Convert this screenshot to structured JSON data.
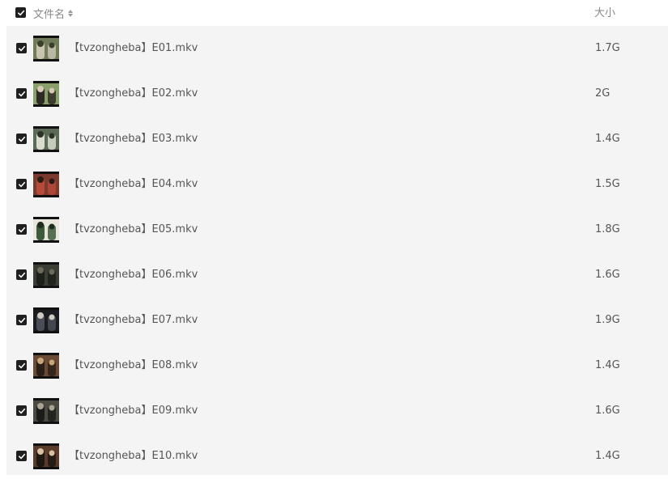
{
  "header": {
    "name_label": "文件名",
    "size_label": "大小",
    "select_all_checked": true
  },
  "files": [
    {
      "name": "【tvzongheba】E01.mkv",
      "size": "1.7G",
      "checked": true,
      "thumb_palette": [
        "#6f7b59",
        "#c8c4b0",
        "#3a3f2c"
      ]
    },
    {
      "name": "【tvzongheba】E02.mkv",
      "size": "2G",
      "checked": true,
      "thumb_palette": [
        "#8aa06a",
        "#2e2a25",
        "#d7c9b4"
      ]
    },
    {
      "name": "【tvzongheba】E03.mkv",
      "size": "1.4G",
      "checked": true,
      "thumb_palette": [
        "#5b6b55",
        "#d9dccf",
        "#2b3126"
      ]
    },
    {
      "name": "【tvzongheba】E04.mkv",
      "size": "1.5G",
      "checked": true,
      "thumb_palette": [
        "#7a3b2e",
        "#b84a3a",
        "#2a1a14"
      ]
    },
    {
      "name": "【tvzongheba】E05.mkv",
      "size": "1.8G",
      "checked": true,
      "thumb_palette": [
        "#e8e6dc",
        "#3d5a3b",
        "#1f2a20"
      ]
    },
    {
      "name": "【tvzongheba】E06.mkv",
      "size": "1.6G",
      "checked": true,
      "thumb_palette": [
        "#3b3e34",
        "#1d1f1a",
        "#6c6a5a"
      ]
    },
    {
      "name": "【tvzongheba】E07.mkv",
      "size": "1.9G",
      "checked": true,
      "thumb_palette": [
        "#1b1c1f",
        "#4a4d55",
        "#d0ccc4"
      ]
    },
    {
      "name": "【tvzongheba】E08.mkv",
      "size": "1.4G",
      "checked": true,
      "thumb_palette": [
        "#6a4a33",
        "#2a2018",
        "#c8a478"
      ]
    },
    {
      "name": "【tvzongheba】E09.mkv",
      "size": "1.6G",
      "checked": true,
      "thumb_palette": [
        "#4b4a42",
        "#1c1c1a",
        "#a8a292"
      ]
    },
    {
      "name": "【tvzongheba】E10.mkv",
      "size": "1.4G",
      "checked": true,
      "thumb_palette": [
        "#5a3a28",
        "#1e1712",
        "#d8c2a2"
      ]
    }
  ]
}
